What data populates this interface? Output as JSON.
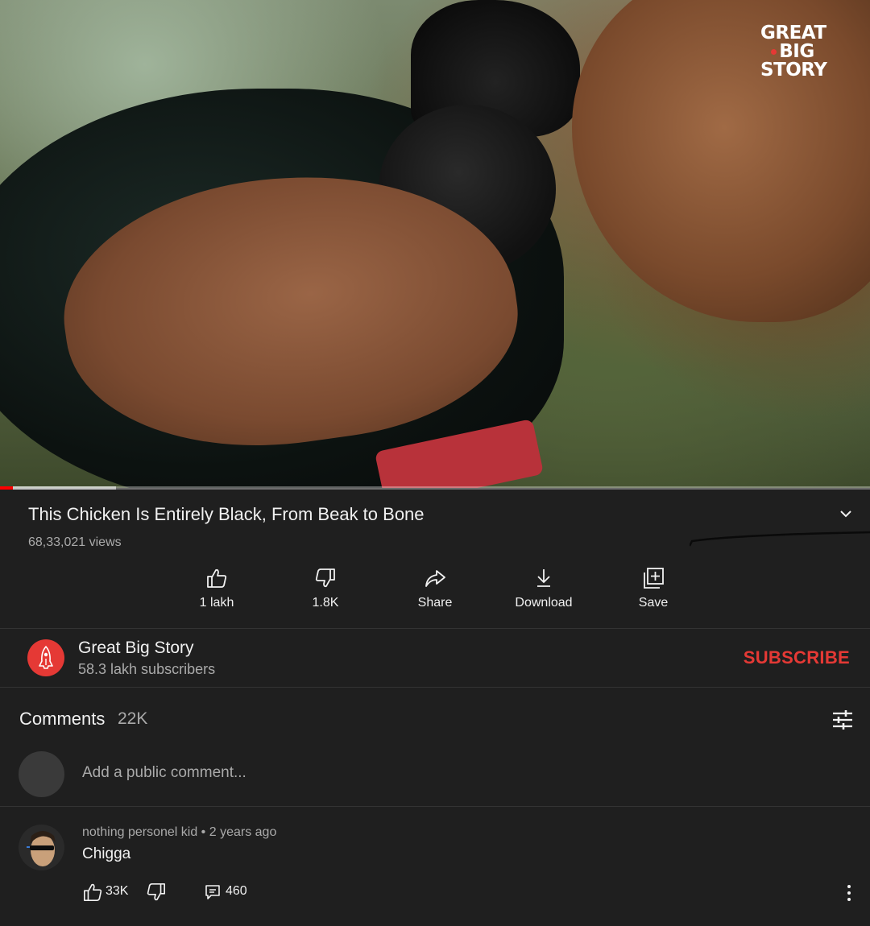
{
  "video": {
    "watermark_line1": "GREAT",
    "watermark_line2": "BIG",
    "watermark_line3": "STORY",
    "progress_played_fraction": 0.015,
    "progress_buffered_fraction": 0.133,
    "title": "This Chicken Is Entirely Black, From Beak to Bone",
    "views": "68,33,021 views"
  },
  "actions": {
    "like_label": "1 lakh",
    "dislike_label": "1.8K",
    "share_label": "Share",
    "download_label": "Download",
    "save_label": "Save"
  },
  "channel": {
    "name": "Great Big Story",
    "subscribers": "58.3 lakh subscribers",
    "subscribe_label": "SUBSCRIBE"
  },
  "comments": {
    "heading": "Comments",
    "count": "22K",
    "add_placeholder": "Add a public comment...",
    "items": [
      {
        "author": "nothing personel kid",
        "separator": "•",
        "time": "2 years ago",
        "text": "Chigga",
        "likes": "33K",
        "replies": "460"
      }
    ]
  },
  "colors": {
    "background": "#1f1f1f",
    "accent_red": "#e53935",
    "text_primary": "#f1f1f1",
    "text_secondary": "#aaaaaa"
  },
  "icons": {
    "like": "thumbs-up-icon",
    "dislike": "thumbs-down-icon",
    "share": "share-arrow-icon",
    "download": "download-icon",
    "save": "add-to-playlist-icon",
    "expand": "chevron-down-icon",
    "filter": "sliders-icon",
    "reply": "comment-bubble-icon",
    "more": "vertical-dots-icon"
  }
}
